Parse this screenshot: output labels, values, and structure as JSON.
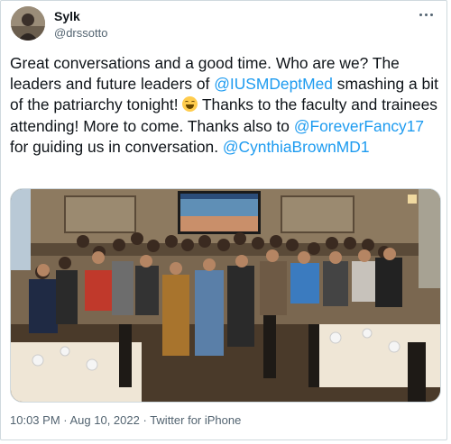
{
  "tweet": {
    "display_name": "Sylk",
    "handle": "@drssotto",
    "text_parts": {
      "p1": "Great conversations and a good time. Who are we? The leaders and future leaders of ",
      "mention1": "@IUSMDeptMed",
      "p2": " smashing a bit of the patriarchy tonight! ",
      "p3": " Thanks to the faculty and trainees attending! More to come. Thanks also to ",
      "mention2": "@ForeverFancy17",
      "p4": " for guiding us in conversation. ",
      "mention3": "@CynthiaBrownMD1"
    },
    "emoji": "laughing-tears-emoji",
    "time": "10:03 PM",
    "separator": " · ",
    "date": "Aug 10, 2022",
    "source": "Twitter for iPhone"
  },
  "colors": {
    "link": "#1d9bf0",
    "secondary_text": "#536471",
    "border": "#cfd9de"
  }
}
